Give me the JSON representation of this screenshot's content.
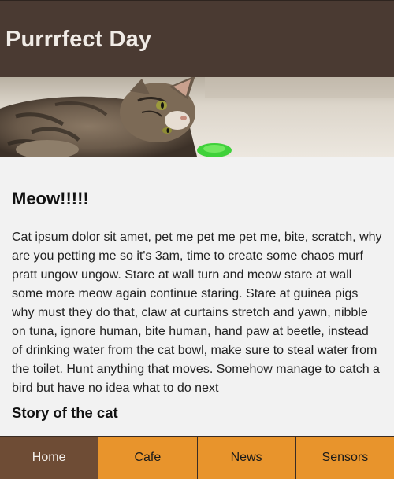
{
  "header": {
    "title": "Purrrfect Day"
  },
  "hero": {
    "image": "cat-lying-on-floor-photo"
  },
  "article": {
    "heading": "Meow!!!!!",
    "paragraph": "Cat ipsum dolor sit amet, pet me pet me pet me, bite, scratch, why are you petting me so it's 3am, time to create some chaos murf pratt ungow ungow. Stare at wall turn and meow stare at wall some more meow again continue staring. Stare at guinea pigs why must they do that, claw at curtains stretch and yawn, nibble on tuna, ignore human, bite human, hand paw at beetle, instead of drinking water from the cat bowl, make sure to steal water from the toilet. Hunt anything that moves. Somehow manage to catch a bird but have no idea what to do next",
    "subheading": "Story of the cat"
  },
  "nav": {
    "items": [
      {
        "label": "Home",
        "active": true
      },
      {
        "label": "Cafe",
        "active": false
      },
      {
        "label": "News",
        "active": false
      },
      {
        "label": "Sensors",
        "active": false
      }
    ]
  },
  "colors": {
    "header_bg": "#4a3a32",
    "nav_bg": "#e8942c",
    "nav_active_bg": "#6e4c35",
    "page_bg": "#f2f2f2"
  }
}
